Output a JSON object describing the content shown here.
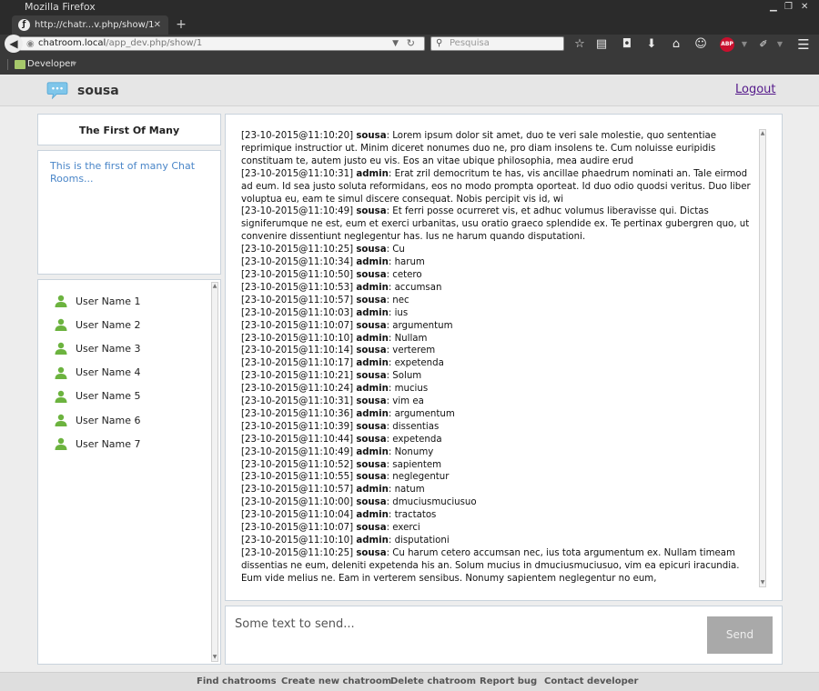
{
  "browser": {
    "window_title": "Mozilla Firefox",
    "tab_title": "http://chatr...v.php/show/1",
    "url_host": "chatroom.local",
    "url_path": "/app_dev.php/show/1",
    "search_placeholder": "Pesquisa",
    "bookmark_folder": "Developer",
    "toolbar_icons": [
      "bookmark-star-icon",
      "reading-list-icon",
      "pocket-icon",
      "download-icon",
      "home-icon",
      "emoji-icon",
      "adblock-icon",
      "tools-icon",
      "menu-icon"
    ],
    "abp_label": "ABP"
  },
  "app": {
    "current_user": "sousa",
    "logout_label": "Logout",
    "accent": "#4a86c8",
    "icon_color": "#6cb33f"
  },
  "room": {
    "title": "The First Of Many",
    "description": "This is the first of many Chat Rooms..."
  },
  "users": [
    {
      "name": "User Name 1"
    },
    {
      "name": "User Name 2"
    },
    {
      "name": "User Name 3"
    },
    {
      "name": "User Name 4"
    },
    {
      "name": "User Name 5"
    },
    {
      "name": "User Name 6"
    },
    {
      "name": "User Name 7"
    }
  ],
  "messages": [
    {
      "ts": "[23-10-2015@11:10:20]",
      "user": "sousa",
      "text": "Lorem ipsum dolor sit amet, duo te veri sale molestie, quo sententiae reprimique instructior ut. Minim diceret nonumes duo ne, pro diam insolens te. Cum noluisse euripidis constituam te, autem justo eu vis. Eos an vitae ubique philosophia, mea audire erud"
    },
    {
      "ts": "[23-10-2015@11:10:31]",
      "user": "admin",
      "text": "Erat zril democritum te has, vis ancillae phaedrum nominati an. Tale eirmod ad eum. Id sea justo soluta reformidans, eos no modo prompta oporteat. Id duo odio quodsi veritus. Duo liber voluptua eu, eam te simul discere consequat. Nobis percipit vis id, wi"
    },
    {
      "ts": "[23-10-2015@11:10:49]",
      "user": "sousa",
      "text": "Et ferri posse ocurreret vis, et adhuc volumus liberavisse qui. Dictas signiferumque ne est, eum et exerci urbanitas, usu oratio graeco splendide ex. Te pertinax gubergren quo, ut convenire dissentiunt neglegentur has. Ius ne harum quando disputationi."
    },
    {
      "ts": "[23-10-2015@11:10:25]",
      "user": "sousa",
      "text": "Cu"
    },
    {
      "ts": "[23-10-2015@11:10:34]",
      "user": "admin",
      "text": "harum"
    },
    {
      "ts": "[23-10-2015@11:10:50]",
      "user": "sousa",
      "text": "cetero"
    },
    {
      "ts": "[23-10-2015@11:10:53]",
      "user": "admin",
      "text": "accumsan"
    },
    {
      "ts": "[23-10-2015@11:10:57]",
      "user": "sousa",
      "text": "nec"
    },
    {
      "ts": "[23-10-2015@11:10:03]",
      "user": "admin",
      "text": "ius"
    },
    {
      "ts": "[23-10-2015@11:10:07]",
      "user": "sousa",
      "text": "argumentum"
    },
    {
      "ts": "[23-10-2015@11:10:10]",
      "user": "admin",
      "text": "Nullam"
    },
    {
      "ts": "[23-10-2015@11:10:14]",
      "user": "sousa",
      "text": "verterem"
    },
    {
      "ts": "[23-10-2015@11:10:17]",
      "user": "admin",
      "text": "expetenda"
    },
    {
      "ts": "[23-10-2015@11:10:21]",
      "user": "sousa",
      "text": "Solum"
    },
    {
      "ts": "[23-10-2015@11:10:24]",
      "user": "admin",
      "text": "mucius"
    },
    {
      "ts": "[23-10-2015@11:10:31]",
      "user": "sousa",
      "text": "vim ea"
    },
    {
      "ts": "[23-10-2015@11:10:36]",
      "user": "admin",
      "text": "argumentum"
    },
    {
      "ts": "[23-10-2015@11:10:39]",
      "user": "sousa",
      "text": "dissentias"
    },
    {
      "ts": "[23-10-2015@11:10:44]",
      "user": "sousa",
      "text": "expetenda"
    },
    {
      "ts": "[23-10-2015@11:10:49]",
      "user": "admin",
      "text": "Nonumy"
    },
    {
      "ts": "[23-10-2015@11:10:52]",
      "user": "sousa",
      "text": "sapientem"
    },
    {
      "ts": "[23-10-2015@11:10:55]",
      "user": "sousa",
      "text": "neglegentur"
    },
    {
      "ts": "[23-10-2015@11:10:57]",
      "user": "admin",
      "text": "natum"
    },
    {
      "ts": "[23-10-2015@11:10:00]",
      "user": "sousa",
      "text": "dmuciusmuciusuo"
    },
    {
      "ts": "[23-10-2015@11:10:04]",
      "user": "admin",
      "text": "tractatos"
    },
    {
      "ts": "[23-10-2015@11:10:07]",
      "user": "sousa",
      "text": "exerci"
    },
    {
      "ts": "[23-10-2015@11:10:10]",
      "user": "admin",
      "text": "disputationi"
    },
    {
      "ts": "[23-10-2015@11:10:25]",
      "user": "sousa",
      "text": "Cu harum cetero accumsan nec, ius tota argumentum ex. Nullam timeam dissentias ne eum, deleniti expetenda his an. Solum mucius in dmuciusmuciusuo, vim ea epicuri iracundia. Eum vide melius ne. Eam in verterem sensibus. Nonumy sapientem neglegentur no eum,"
    }
  ],
  "compose": {
    "value": "Some text to send...",
    "send_label": "Send"
  },
  "footer": {
    "links": [
      "Find chatrooms",
      "Create new chatroom",
      "Delete chatroom",
      "Report bug",
      "Contact developer"
    ]
  }
}
